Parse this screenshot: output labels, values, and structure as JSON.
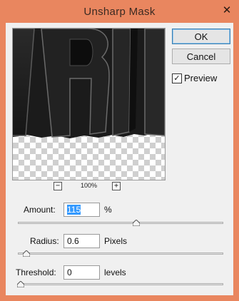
{
  "dialog": {
    "title": "Unsharp Mask",
    "close_glyph": "✕"
  },
  "buttons": {
    "ok": "OK",
    "cancel": "Cancel"
  },
  "preview": {
    "label": "Preview",
    "checked": true,
    "check_glyph": "✓"
  },
  "zoom": {
    "level": "100%",
    "minus": "−",
    "plus": "+"
  },
  "amount": {
    "label": "Amount:",
    "value": "115",
    "unit": "%",
    "slider_fraction": 0.58
  },
  "radius": {
    "label": "Radius:",
    "value": "0.6",
    "unit": "Pixels",
    "slider_fraction": 0.03
  },
  "threshold": {
    "label": "Threshold:",
    "value": "0",
    "unit": "levels",
    "slider_fraction": 0.0
  }
}
